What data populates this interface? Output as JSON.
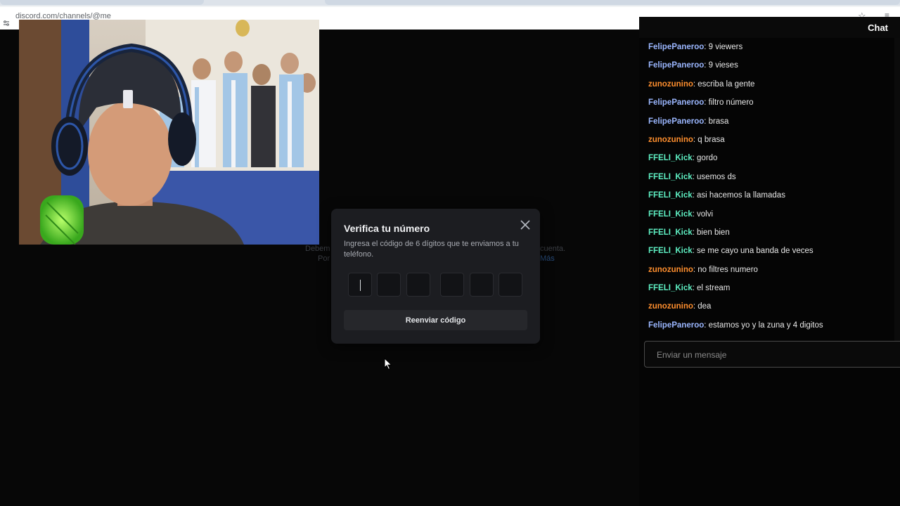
{
  "browser": {
    "url": "discord.com/channels/@me"
  },
  "background_text": {
    "line1_start": "Debem",
    "line1_end": "cuenta.",
    "line2_start": "Por",
    "line2_end": "Más"
  },
  "modal": {
    "title": "Verifica tu número",
    "description": "Ingresa el código de 6 dígitos que te enviamos a tu teléfono.",
    "code_digits": [
      "",
      "",
      "",
      "",
      "",
      ""
    ],
    "resend_label": "Reenviar código",
    "close_icon": "close-icon"
  },
  "chat": {
    "title": "Chat",
    "input_placeholder": "Enviar un mensaje",
    "user_colors": {
      "FelipePaneroo": "#9bb7ff",
      "zunozunino": "#ff8f2e",
      "FFELI_Kick": "#5ef0c3"
    },
    "messages": [
      {
        "user": "FelipePaneroo",
        "text": "9 viewers"
      },
      {
        "user": "FelipePaneroo",
        "text": "9 vieses"
      },
      {
        "user": "zunozunino",
        "text": "escriba la gente"
      },
      {
        "user": "FelipePaneroo",
        "text": "filtro número"
      },
      {
        "user": "FelipePaneroo",
        "text": "brasa"
      },
      {
        "user": "zunozunino",
        "text": "q brasa"
      },
      {
        "user": "FFELI_Kick",
        "text": "gordo"
      },
      {
        "user": "FFELI_Kick",
        "text": "usemos ds"
      },
      {
        "user": "FFELI_Kick",
        "text": "asi hacemos la llamadas"
      },
      {
        "user": "FFELI_Kick",
        "text": "volvi"
      },
      {
        "user": "FFELI_Kick",
        "text": "bien bien"
      },
      {
        "user": "FFELI_Kick",
        "text": "se me cayo una banda de veces"
      },
      {
        "user": "zunozunino",
        "text": "no filtres numero"
      },
      {
        "user": "FFELI_Kick",
        "text": "el stream"
      },
      {
        "user": "zunozunino",
        "text": "dea"
      },
      {
        "user": "FelipePaneroo",
        "text": "estamos yo y la zuna y 4 digitos"
      }
    ]
  }
}
